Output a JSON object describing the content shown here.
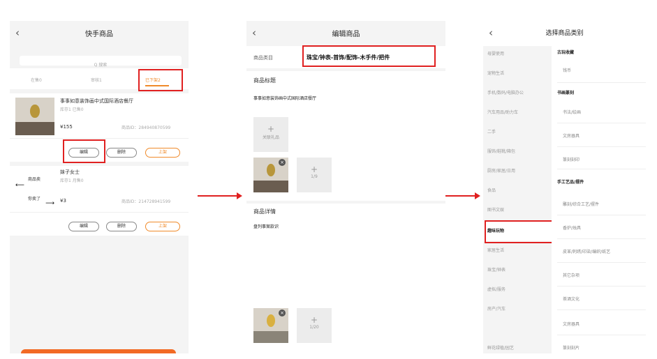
{
  "colors": {
    "accent_orange": "#f08a2a",
    "highlight_red": "#e02020",
    "arrow_red": "#e02020"
  },
  "screen1": {
    "title": "快手商品",
    "back_icon": "chevron-left-icon",
    "search_placeholder": "Q 搜索",
    "tabs": [
      "在售0",
      "审核1",
      "已下架2"
    ],
    "product1": {
      "title": "事事如意装饰画中式国际酒店餐厅",
      "meta": "库存1 已售0",
      "price": "¥155",
      "product_id": "商品ID：284940870599",
      "buttons": [
        "编辑",
        "删除",
        "上架"
      ]
    },
    "product2": {
      "title": "妹子女士",
      "meta": "库存1 月售0",
      "price": "¥3",
      "product_id": "商品ID：214728941599",
      "annotation_top": "商品卖",
      "annotation_bottom": "你卖了",
      "buttons": [
        "编辑",
        "删除",
        "上架"
      ]
    }
  },
  "screen2": {
    "title": "编辑商品",
    "back_icon": "chevron-left-icon",
    "category_label": "商品类目",
    "category_value": "珠宝/钟表-首饰/配饰-木手件/把件",
    "title_label": "商品标题",
    "title_value": "事事如意装饰画中式国际酒店餐厅",
    "add_image_label": "关联礼品",
    "main_image_count": "1/9",
    "detail_label": "商品详情",
    "detail_text": "盘列事案款识",
    "detail_image_count": "1/20"
  },
  "screen3": {
    "title": "选择商品类别",
    "back_icon": "chevron-left-icon",
    "left_categories": [
      "母婴使用",
      "宠物生活",
      "手机/数码/电脑办公",
      "汽车用品/助力车",
      "二手",
      "服饰/鞋靴/箱包",
      "厨房/家居/日用",
      "食品",
      "图书文娱",
      "趣味玩物",
      "家居生活",
      "珠宝/钟表",
      "虚拟/服务",
      "房产/汽车",
      "鲜花绿植/园艺"
    ],
    "selected_category": "趣味玩物",
    "groups": [
      {
        "name": "古玩收藏",
        "items": [
          "钱币"
        ]
      },
      {
        "name": "书画篆刻",
        "items": [
          "书法/绘画",
          "文房器具",
          "篆刻刻印"
        ]
      },
      {
        "name": "手工艺品/摆件",
        "items": [
          "雕刻/综合工艺/摆件",
          "香炉/烛具",
          "皮革/刺绣/印染/编织/纸艺",
          "其它杂项",
          "茶酒文化",
          "文房器具",
          "篆刻刻片"
        ]
      }
    ]
  }
}
